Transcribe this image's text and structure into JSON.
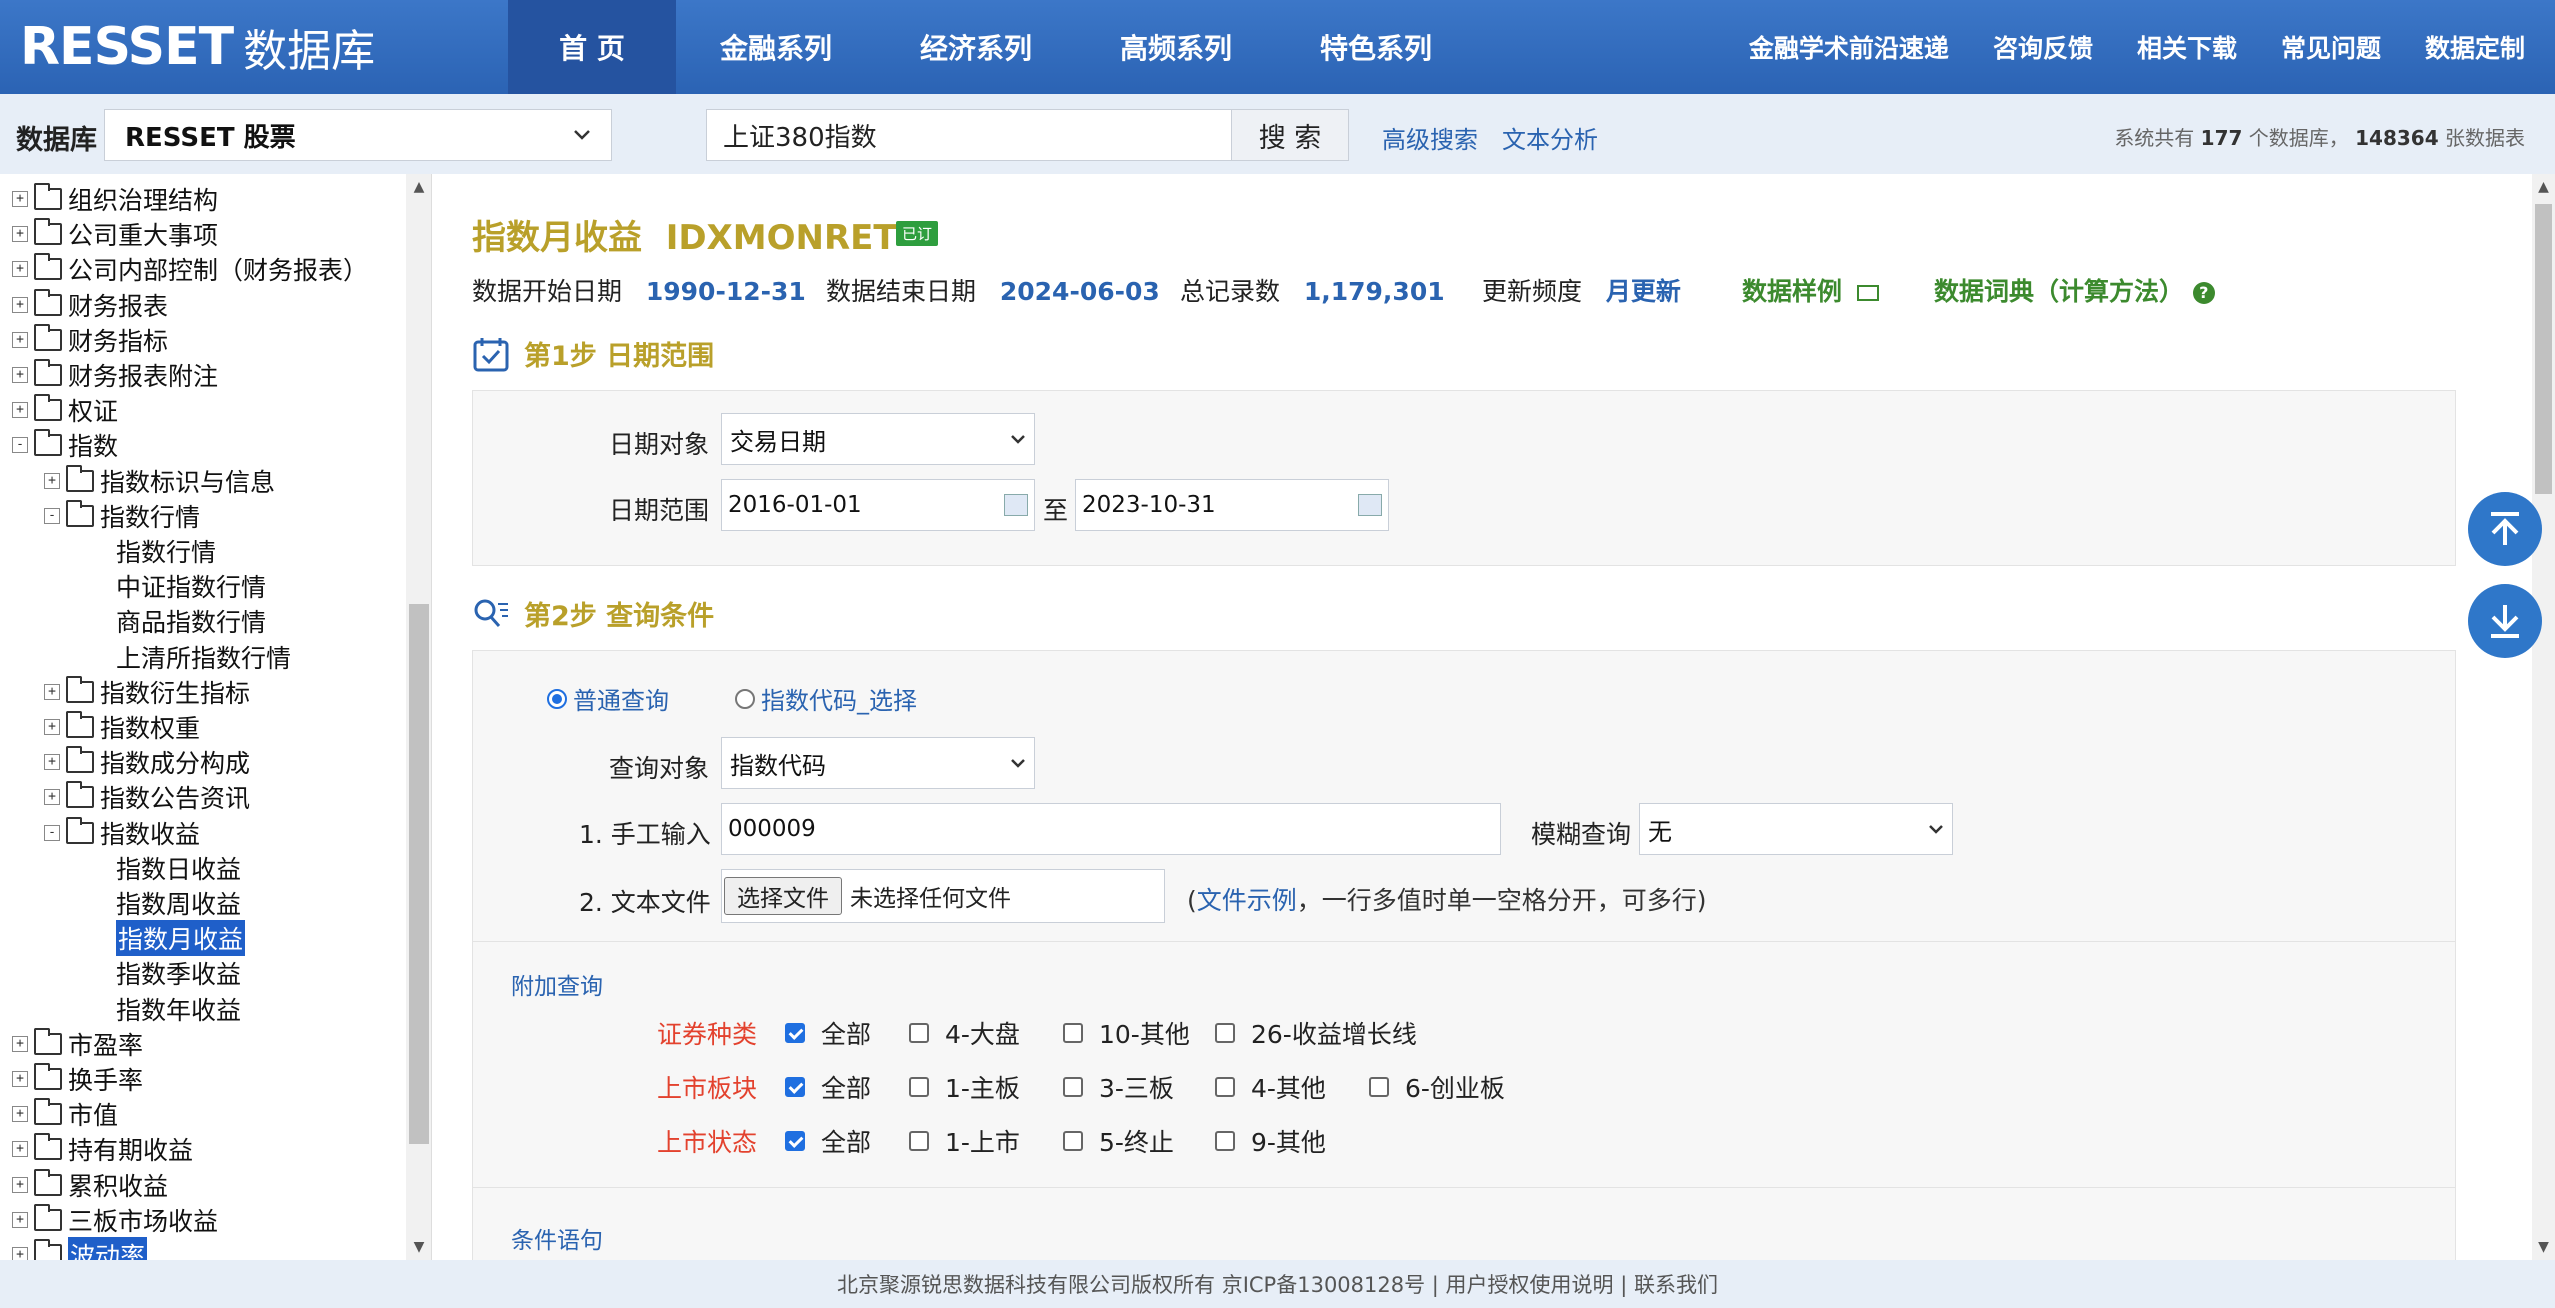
{
  "header": {
    "logo_en": "RESSET",
    "logo_cn": "数据库",
    "nav": [
      "首 页",
      "金融系列",
      "经济系列",
      "高频系列",
      "特色系列"
    ],
    "nav_right": [
      "金融学术前沿速递",
      "咨询反馈",
      "相关下载",
      "常见问题",
      "数据定制"
    ]
  },
  "searchbar": {
    "db_label": "数据库",
    "db_value": "RESSET 股票",
    "search_value": "上证380指数",
    "search_btn": "搜 索",
    "advanced": "高级搜索",
    "text_analysis": "文本分析",
    "sys_prefix": "系统共有",
    "db_count": "177",
    "db_unit": "个数据库，",
    "table_count": "148364",
    "table_unit": "张数据表"
  },
  "tree": [
    {
      "label": "组织治理结构",
      "level": 0,
      "toggle": "+"
    },
    {
      "label": "公司重大事项",
      "level": 0,
      "toggle": "+"
    },
    {
      "label": "公司内部控制（财务报表）",
      "level": 0,
      "toggle": "+"
    },
    {
      "label": "财务报表",
      "level": 0,
      "toggle": "+"
    },
    {
      "label": "财务指标",
      "level": 0,
      "toggle": "+"
    },
    {
      "label": "财务报表附注",
      "level": 0,
      "toggle": "+"
    },
    {
      "label": "权证",
      "level": 0,
      "toggle": "+"
    },
    {
      "label": "指数",
      "level": 0,
      "toggle": "-"
    },
    {
      "label": "指数标识与信息",
      "level": 1,
      "toggle": "+"
    },
    {
      "label": "指数行情",
      "level": 1,
      "toggle": "-"
    },
    {
      "label": "指数行情",
      "level": 2
    },
    {
      "label": "中证指数行情",
      "level": 2
    },
    {
      "label": "商品指数行情",
      "level": 2
    },
    {
      "label": "上清所指数行情",
      "level": 2
    },
    {
      "label": "指数衍生指标",
      "level": 1,
      "toggle": "+"
    },
    {
      "label": "指数权重",
      "level": 1,
      "toggle": "+"
    },
    {
      "label": "指数成分构成",
      "level": 1,
      "toggle": "+"
    },
    {
      "label": "指数公告资讯",
      "level": 1,
      "toggle": "+"
    },
    {
      "label": "指数收益",
      "level": 1,
      "toggle": "-"
    },
    {
      "label": "指数日收益",
      "level": 2
    },
    {
      "label": "指数周收益",
      "level": 2
    },
    {
      "label": "指数月收益",
      "level": 2,
      "selected": true
    },
    {
      "label": "指数季收益",
      "level": 2
    },
    {
      "label": "指数年收益",
      "level": 2
    },
    {
      "label": "市盈率",
      "level": 0,
      "toggle": "+"
    },
    {
      "label": "换手率",
      "level": 0,
      "toggle": "+"
    },
    {
      "label": "市值",
      "level": 0,
      "toggle": "+"
    },
    {
      "label": "持有期收益",
      "level": 0,
      "toggle": "+"
    },
    {
      "label": "累积收益",
      "level": 0,
      "toggle": "+"
    },
    {
      "label": "三板市场收益",
      "level": 0,
      "toggle": "+"
    },
    {
      "label": "波动率",
      "level": 0,
      "toggle": "+",
      "selected": true
    }
  ],
  "page": {
    "title": "指数月收益",
    "code": "IDXMONRET",
    "badge": "已订",
    "start_label": "数据开始日期",
    "start": "1990-12-31",
    "end_label": "数据结束日期",
    "end": "2024-06-03",
    "records_label": "总记录数",
    "records": "1,179,301",
    "freq_label": "更新频度",
    "freq": "月更新",
    "sample": "数据样例",
    "dict": "数据词典（计算方法）"
  },
  "step1": {
    "title": "第1步 日期范围",
    "date_obj_label": "日期对象",
    "date_obj": "交易日期",
    "range_label": "日期范围",
    "from": "2016-01-01",
    "to_label": "至",
    "to": "2023-10-31"
  },
  "step2": {
    "title": "第2步 查询条件",
    "radio1": "普通查询",
    "radio2": "指数代码_选择",
    "query_obj_label": "查询对象",
    "query_obj": "指数代码",
    "manual_label": "1. 手工输入",
    "manual_value": "000009",
    "fuzzy_label": "模糊查询",
    "fuzzy_value": "无",
    "file_label": "2. 文本文件",
    "file_btn": "选择文件",
    "file_none": "未选择任何文件",
    "note_open": "(",
    "note_link": "文件示例",
    "note_rest": "，一行多值时单一空格分开，可多行)",
    "extra_title": "附加查询",
    "rows": [
      {
        "label": "证券种类",
        "options": [
          {
            "t": "全部",
            "on": true
          },
          {
            "t": "4-大盘"
          },
          {
            "t": "10-其他"
          },
          {
            "t": "26-收益增长线"
          }
        ]
      },
      {
        "label": "上市板块",
        "options": [
          {
            "t": "全部",
            "on": true
          },
          {
            "t": "1-主板"
          },
          {
            "t": "3-三板"
          },
          {
            "t": "4-其他"
          },
          {
            "t": "6-创业板"
          }
        ]
      },
      {
        "label": "上市状态",
        "options": [
          {
            "t": "全部",
            "on": true
          },
          {
            "t": "1-上市"
          },
          {
            "t": "5-终止"
          },
          {
            "t": "9-其他"
          }
        ]
      }
    ],
    "cond_title": "条件语句"
  },
  "footer": "北京聚源锐思数据科技有限公司版权所有  京ICP备13008128号 | 用户授权使用说明 | 联系我们",
  "colors": {
    "brand_blue": "#2b63b4",
    "title_gold": "#b9a02a",
    "link_blue": "#2a63b0",
    "label_red": "#e3422e",
    "green": "#3c8a2e"
  }
}
